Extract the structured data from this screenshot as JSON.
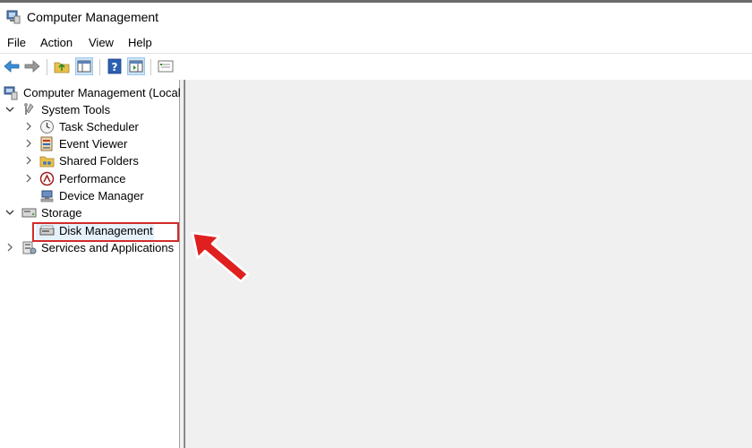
{
  "window": {
    "title": "Computer Management"
  },
  "menu": {
    "file": "File",
    "action": "Action",
    "view": "View",
    "help": "Help"
  },
  "toolbar": {
    "buttons": [
      "back-icon",
      "forward-icon",
      "up-folder-icon",
      "show-hide-tree-icon",
      "help-icon",
      "action-pane-icon",
      "properties-icon"
    ]
  },
  "tree": {
    "root": "Computer Management (Local",
    "system_tools": "System Tools",
    "task_scheduler": "Task Scheduler",
    "event_viewer": "Event Viewer",
    "shared_folders": "Shared Folders",
    "performance": "Performance",
    "device_manager": "Device Manager",
    "storage": "Storage",
    "disk_management": "Disk Management",
    "services_apps": "Services and Applications"
  },
  "colors": {
    "highlight_box": "#d32a2a",
    "arrow": "#e02020",
    "selection": "#e5f1fb"
  }
}
